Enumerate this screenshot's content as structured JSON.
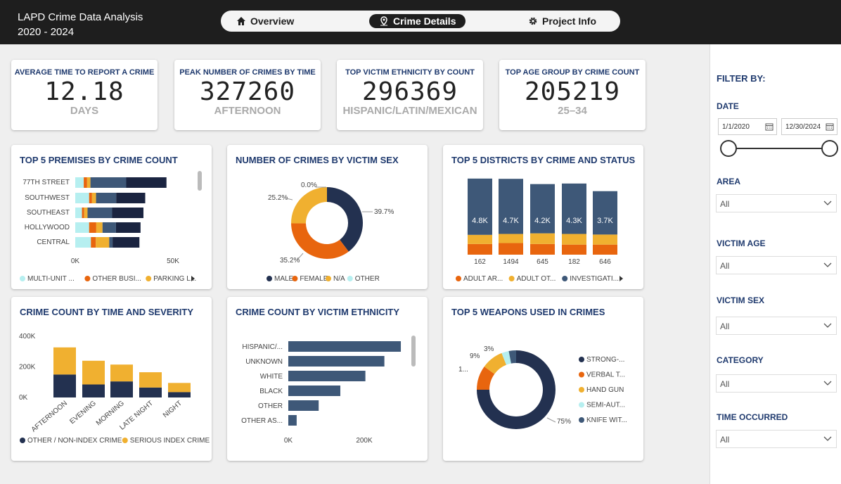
{
  "app": {
    "title_line1": "LAPD Crime Data Analysis",
    "title_line2": "2020 - 2024"
  },
  "nav": {
    "tabs": [
      "Overview",
      "Crime Details",
      "Project Info"
    ],
    "active": 1
  },
  "kpis": [
    {
      "title": "AVERAGE TIME TO REPORT A CRIME",
      "value": "12.18",
      "sub": "DAYS"
    },
    {
      "title": "PEAK NUMBER OF CRIMES BY TIME",
      "value": "327260",
      "sub": "AFTERNOON"
    },
    {
      "title": "TOP VICTIM ETHNICITY BY COUNT",
      "value": "296369",
      "sub": "HISPANIC/LATIN/MEXICAN"
    },
    {
      "title": "TOP AGE GROUP BY CRIME COUNT",
      "value": "205219",
      "sub": "25–34"
    }
  ],
  "colors": {
    "navy": "#233150",
    "slate": "#3e5878",
    "orange": "#e8650e",
    "gold": "#f0b030",
    "cyan": "#b6eff0",
    "dark_header": "#1e1e1e"
  },
  "charts": {
    "premises": {
      "title": "TOP 5 PREMISES BY CRIME COUNT",
      "legend": [
        "MULTI-UNIT ...",
        "OTHER BUSI...",
        "PARKING L..."
      ],
      "axis": [
        "0K",
        "50K"
      ]
    },
    "victim_sex": {
      "title": "NUMBER OF CRIMES BY VICTIM SEX",
      "labels": [
        "0.0%",
        "25.2%",
        "35.2%",
        "39.7%"
      ],
      "legend": [
        "MALE",
        "FEMALE",
        "N/A",
        "OTHER"
      ]
    },
    "districts": {
      "title": "TOP 5 DISTRICTS BY CRIME AND STATUS",
      "legend": [
        "ADULT AR...",
        "ADULT OT...",
        "INVESTIGATI..."
      ]
    },
    "time_severity": {
      "title": "CRIME COUNT BY TIME AND SEVERITY",
      "legend": [
        "OTHER / NON-INDEX CRIME",
        "SERIOUS INDEX CRIME"
      ]
    },
    "ethnicity": {
      "title": "CRIME COUNT BY VICTIM ETHNICITY",
      "axis": [
        "0K",
        "200K"
      ]
    },
    "weapons": {
      "title": "TOP 5 WEAPONS USED IN CRIMES",
      "labels": [
        "3%",
        "9%",
        "1...",
        "75%"
      ],
      "legend": [
        "STRONG-...",
        "VERBAL T...",
        "HAND GUN",
        "SEMI-AUT...",
        "KNIFE WIT..."
      ]
    }
  },
  "chart_data": [
    {
      "type": "bar",
      "title": "TOP 5 PREMISES BY CRIME COUNT",
      "orientation": "horizontal-stacked",
      "categories": [
        "77TH STREET",
        "SOUTHWEST",
        "SOUTHEAST",
        "HOLLYWOOD",
        "CENTRAL"
      ],
      "series": [
        {
          "name": "MULTI-UNIT ...",
          "values": [
            3800,
            6200,
            3000,
            6200,
            7000
          ],
          "color": "#b6eff0"
        },
        {
          "name": "OTHER BUSI...",
          "values": [
            1500,
            1300,
            1000,
            3200,
            2200
          ],
          "color": "#e8650e"
        },
        {
          "name": "PARKING L...",
          "values": [
            1500,
            1800,
            1500,
            2800,
            6000
          ],
          "color": "#f0b030"
        },
        {
          "values": [
            16000,
            9000,
            11000,
            6000,
            1500
          ],
          "color": "#3e5878"
        },
        {
          "values": [
            18000,
            13000,
            14000,
            11000,
            12000
          ],
          "color": "#1a2440"
        }
      ],
      "xlim": [
        0,
        50000
      ],
      "xticks": [
        "0K",
        "50K"
      ]
    },
    {
      "type": "pie",
      "title": "NUMBER OF CRIMES BY VICTIM SEX",
      "categories": [
        "MALE",
        "FEMALE",
        "N/A",
        "OTHER"
      ],
      "values": [
        39.7,
        35.2,
        25.2,
        0.0
      ],
      "colors": [
        "#233150",
        "#e8650e",
        "#f0b030",
        "#b6eff0"
      ]
    },
    {
      "type": "bar",
      "title": "TOP 5 DISTRICTS BY CRIME AND STATUS",
      "categories": [
        "162",
        "1494",
        "645",
        "182",
        "646"
      ],
      "series": [
        {
          "name": "ADULT AR...",
          "values": [
            0.35,
            0.38,
            0.35,
            0.33,
            0.33
          ],
          "color": "#e8650e"
        },
        {
          "name": "ADULT OT...",
          "values": [
            0.3,
            0.3,
            0.35,
            0.35,
            0.33
          ],
          "color": "#f0b030"
        },
        {
          "name": "INVESTIGATI...",
          "values": [
            4.8,
            4.7,
            4.2,
            4.3,
            3.7
          ],
          "color": "#3e5878"
        }
      ],
      "labels": [
        "4.8K",
        "4.7K",
        "4.2K",
        "4.3K",
        "3.7K"
      ]
    },
    {
      "type": "bar",
      "title": "CRIME COUNT BY TIME AND SEVERITY",
      "categories": [
        "AFTERNOON",
        "EVENING",
        "MORNING",
        "LATE NIGHT",
        "NIGHT"
      ],
      "series": [
        {
          "name": "OTHER / NON-INDEX CRIME",
          "values": [
            150000,
            85000,
            105000,
            65000,
            35000
          ],
          "color": "#233150"
        },
        {
          "name": "SERIOUS INDEX CRIME",
          "values": [
            177260,
            155000,
            110000,
            100000,
            60000
          ],
          "color": "#f0b030"
        }
      ],
      "ylim": [
        0,
        400000
      ],
      "yticks": [
        "0K",
        "200K",
        "400K"
      ]
    },
    {
      "type": "bar",
      "title": "CRIME COUNT BY VICTIM ETHNICITY",
      "orientation": "horizontal",
      "categories": [
        "HISPANIC/...",
        "UNKNOWN",
        "WHITE",
        "BLACK",
        "OTHER",
        "OTHER AS..."
      ],
      "values": [
        296369,
        253000,
        203000,
        137000,
        80000,
        22000
      ],
      "xlim": [
        0,
        300000
      ],
      "xticks": [
        "0K",
        "200K"
      ]
    },
    {
      "type": "pie",
      "title": "TOP 5 WEAPONS USED IN CRIMES",
      "categories": [
        "STRONG-...",
        "VERBAL T...",
        "HAND GUN",
        "SEMI-AUT...",
        "KNIFE WIT..."
      ],
      "values": [
        75,
        10,
        9,
        3,
        3
      ],
      "colors": [
        "#233150",
        "#e8650e",
        "#f0b030",
        "#b6eff0",
        "#3e5878"
      ]
    }
  ],
  "filters": {
    "header": "FILTER BY:",
    "date_label": "DATE",
    "date_start": "1/1/2020",
    "date_end": "12/30/2024",
    "range_start": 0.0,
    "range_end": 1.0,
    "items": [
      {
        "label": "AREA",
        "value": "All"
      },
      {
        "label": "VICTIM AGE",
        "value": "All"
      },
      {
        "label": "VICTIM SEX",
        "value": "All"
      },
      {
        "label": "CATEGORY",
        "value": "All"
      },
      {
        "label": "TIME OCCURRED",
        "value": "All"
      }
    ]
  }
}
